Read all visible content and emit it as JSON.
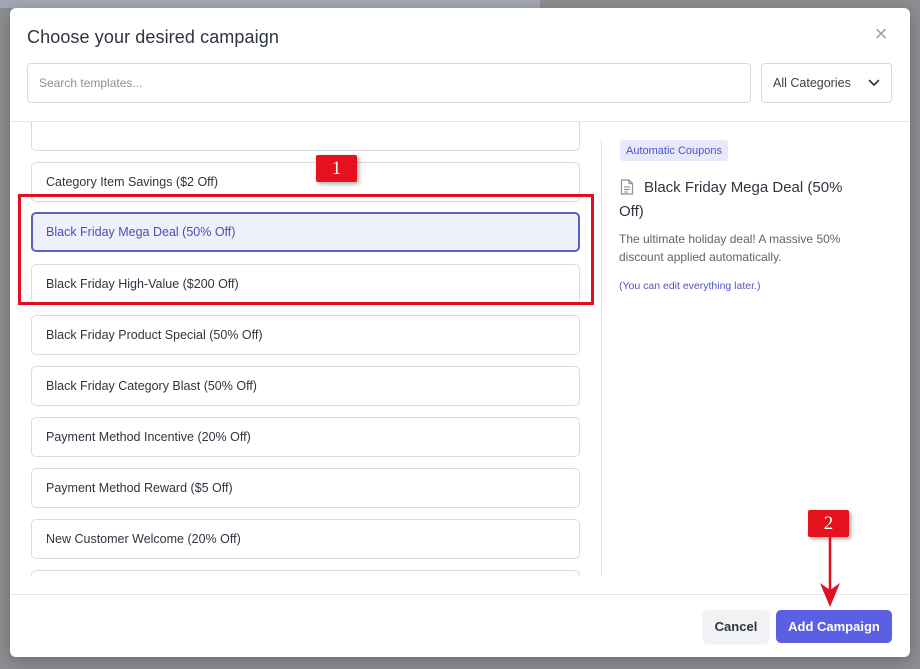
{
  "modal": {
    "title": "Choose your desired campaign",
    "close_glyph": "×"
  },
  "search": {
    "placeholder": "Search templates...",
    "value": ""
  },
  "category_filter": {
    "selected": "All Categories"
  },
  "templates": [
    {
      "label": "",
      "partial": true
    },
    {
      "label": "Category Item Savings ($2 Off)"
    },
    {
      "label": "Black Friday Mega Deal (50% Off)",
      "selected": true
    },
    {
      "label": "Black Friday High-Value ($200 Off)"
    },
    {
      "label": "Black Friday Product Special (50% Off)"
    },
    {
      "label": "Black Friday Category Blast (50% Off)"
    },
    {
      "label": "Payment Method Incentive (20% Off)"
    },
    {
      "label": "Payment Method Reward ($5 Off)"
    },
    {
      "label": "New Customer Welcome (20% Off)"
    },
    {
      "label": "",
      "partial": true
    }
  ],
  "preview": {
    "badge": "Automatic Coupons",
    "icon": "document-icon",
    "title": "Black Friday Mega Deal (50% Off)",
    "description": "The ultimate holiday deal! A massive 50% discount applied automatically.",
    "note": "(You can edit everything later.)"
  },
  "footer": {
    "cancel_label": "Cancel",
    "add_label": "Add Campaign"
  },
  "annotations": {
    "step1": "1",
    "step2": "2"
  },
  "colors": {
    "accent": "#5b5fe3",
    "selected_border": "#5a5fc9",
    "selected_bg": "#eef0fc",
    "annotation_red": "#e01020"
  }
}
